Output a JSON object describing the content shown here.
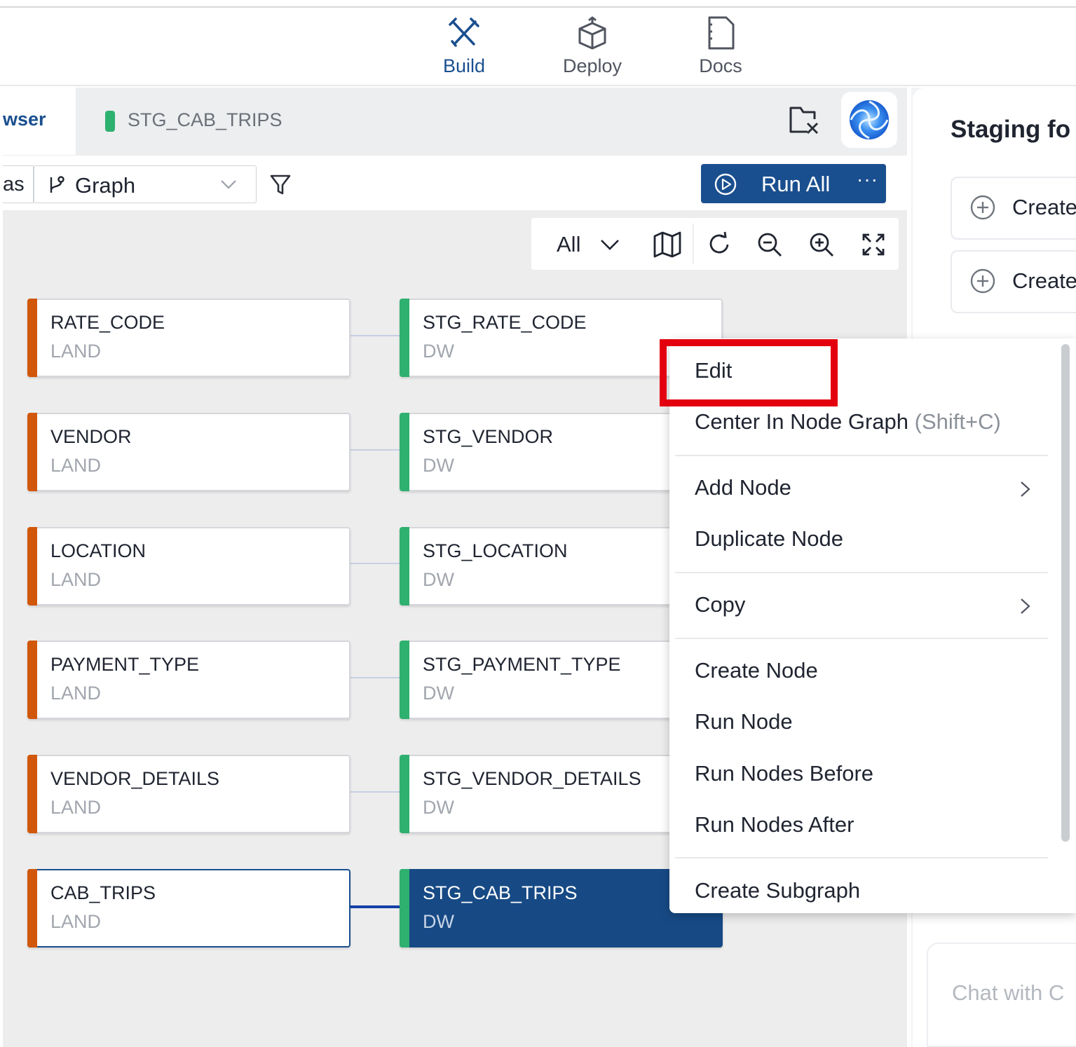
{
  "nav": {
    "items": [
      {
        "label": "Build",
        "icon": "build-icon",
        "active": true
      },
      {
        "label": "Deploy",
        "icon": "deploy-icon",
        "active": false
      },
      {
        "label": "Docs",
        "icon": "docs-icon",
        "active": false
      }
    ]
  },
  "tabs": {
    "browser_label": "wser",
    "active_tab_label": "STG_CAB_TRIPS"
  },
  "toolbar": {
    "view_left_fragment": "as",
    "graph_select_label": "Graph",
    "run_all_label": "Run All",
    "run_all_more": "···"
  },
  "graph_controls": {
    "filter_value": "All"
  },
  "nodes": {
    "source": [
      {
        "name": "RATE_CODE",
        "type": "LAND"
      },
      {
        "name": "VENDOR",
        "type": "LAND"
      },
      {
        "name": "LOCATION",
        "type": "LAND"
      },
      {
        "name": "PAYMENT_TYPE",
        "type": "LAND"
      },
      {
        "name": "VENDOR_DETAILS",
        "type": "LAND"
      },
      {
        "name": "CAB_TRIPS",
        "type": "LAND"
      }
    ],
    "staging": [
      {
        "name": "STG_RATE_CODE",
        "type": "DW"
      },
      {
        "name": "STG_VENDOR",
        "type": "DW"
      },
      {
        "name": "STG_LOCATION",
        "type": "DW"
      },
      {
        "name": "STG_PAYMENT_TYPE",
        "type": "DW"
      },
      {
        "name": "STG_VENDOR_DETAILS",
        "type": "DW"
      },
      {
        "name": "STG_CAB_TRIPS",
        "type": "DW",
        "selected": true
      }
    ]
  },
  "context_menu": {
    "edit": "Edit",
    "center": "Center In Node Graph",
    "center_hint": "(Shift+C)",
    "add_node": "Add Node",
    "duplicate_node": "Duplicate Node",
    "copy": "Copy",
    "create_node": "Create Node",
    "run_node": "Run Node",
    "run_nodes_before": "Run Nodes Before",
    "run_nodes_after": "Run Nodes After",
    "create_subgraph": "Create Subgraph"
  },
  "right_panel": {
    "title": "Staging fo",
    "options": [
      "Create",
      "Create"
    ],
    "chat_placeholder": "Chat with C"
  },
  "colors": {
    "primary": "#1a4f8f",
    "land_stripe": "#d1570b",
    "dw_stripe": "#2eb06f",
    "highlight_box": "#e3000f"
  }
}
